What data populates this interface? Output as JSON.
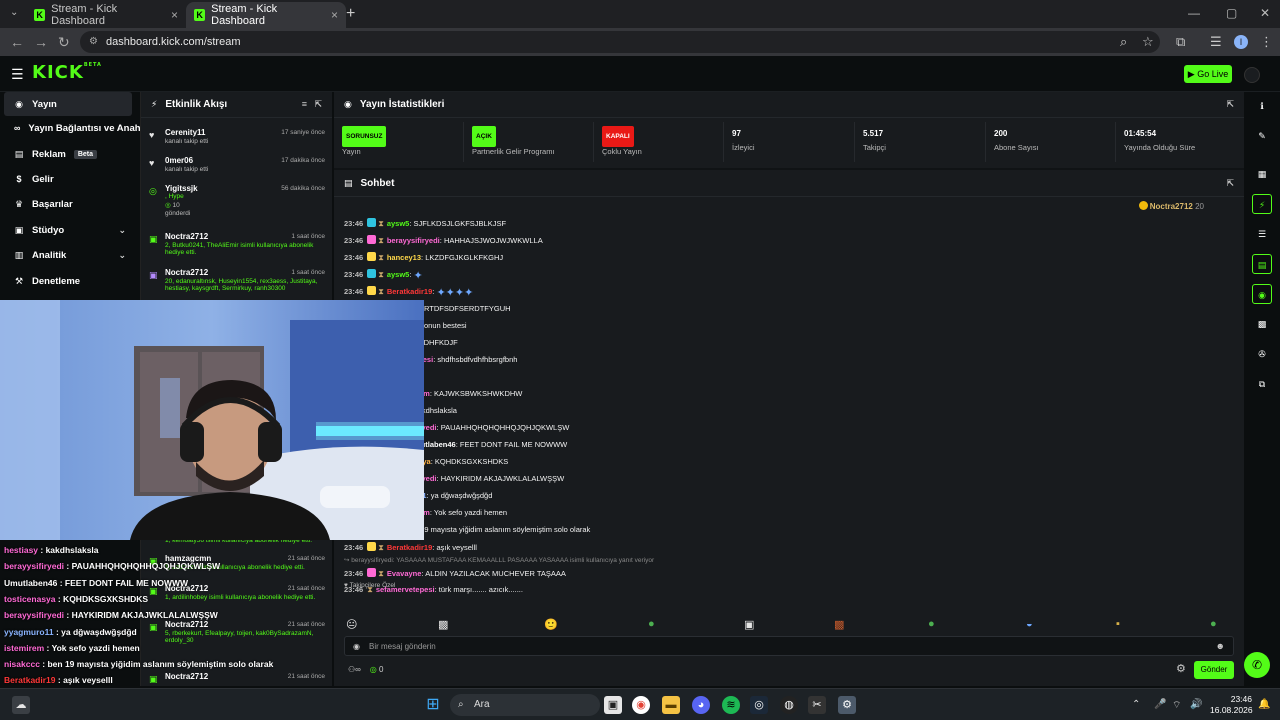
{
  "browser": {
    "tabs": [
      {
        "title": "Stream - Kick Dashboard",
        "favicon": "K"
      },
      {
        "title": "Stream - Kick Dashboard",
        "favicon": "K"
      }
    ],
    "url": "dashboard.kick.com/stream",
    "profile_initial": "I"
  },
  "topbar": {
    "logo": "KICK",
    "logo_beta": "BETA",
    "go_live_label": "Go Live"
  },
  "sidebar": {
    "items": [
      {
        "label": "Yayın",
        "icon": "broadcast-icon"
      },
      {
        "label": "Yayın Bağlantısı ve Anahtarı",
        "icon": "link-icon"
      },
      {
        "label": "Reklam",
        "icon": "ad-icon",
        "badge": "Beta"
      },
      {
        "label": "Gelir",
        "icon": "dollar-icon"
      },
      {
        "label": "Başarılar",
        "icon": "trophy-icon"
      },
      {
        "label": "Stüdyo",
        "icon": "studio-icon"
      },
      {
        "label": "Analitik",
        "icon": "chart-icon"
      },
      {
        "label": "Denetleme",
        "icon": "hammer-icon"
      }
    ]
  },
  "feed": {
    "title": "Etkinlik Akışı",
    "items": [
      {
        "user": "Cerenity11",
        "time": "17 saniye önce",
        "desc": "kanalı takip etti"
      },
      {
        "user": "0mer06",
        "time": "17 dakika önce",
        "desc": "kanalı takip etti"
      },
      {
        "user": "Yigitssjk",
        "time": "56 dakika önce",
        "desc": ", Hype",
        "extra": "10",
        "extra2": "gönderdi"
      },
      {
        "user": "Noctra2712",
        "time": "1 saat önce",
        "desc": "2, Butku0241, TheAliEmir isimli kullanıcıya abonelik hediye etti."
      },
      {
        "user": "Noctra2712",
        "time": "1 saat önce",
        "desc": "20, edanuraltınsk, Huseyin1554, rex3aess, Justitaya, hestiasy, kaysgrdft, Sermirkuy, ranh30300"
      },
      {
        "user": "",
        "time": "",
        "desc": "1, kemoaty56 isimli kullanıcıya abonelik hediye etti."
      },
      {
        "user": "hamzagcmn",
        "time": "21 saat önce",
        "desc": "1, azizzzzs isimli kullanıcıya abonelik hediye etti."
      },
      {
        "user": "Noctra2712",
        "time": "21 saat önce",
        "desc": "1, ardilinhobey isimli kullanıcıya abonelik hediye etti."
      },
      {
        "user": "Noctra2712",
        "time": "21 saat önce",
        "desc": "5, rberkekurt, Efealpayy, toijen, kak0BySadrazamN, erdoly_30"
      },
      {
        "user": "Noctra2712",
        "time": "21 saat önce",
        "desc": ""
      }
    ]
  },
  "stats": {
    "title": "Yayın İstatistikleri",
    "items": [
      {
        "badge": "SORUNSUZ",
        "label": "Yayın",
        "color": "green"
      },
      {
        "badge": "AÇIK",
        "label": "Partnerlik Gelir Programı",
        "color": "green"
      },
      {
        "badge": "KAPALI",
        "label": "Çoklu Yayın",
        "color": "red"
      },
      {
        "value": "97",
        "label": "İzleyici"
      },
      {
        "value": "5.517",
        "label": "Takipçi"
      },
      {
        "value": "200",
        "label": "Abone Sayısı"
      },
      {
        "value": "01:45:54",
        "label": "Yayında Olduğu Süre"
      }
    ]
  },
  "chat": {
    "title": "Sohbet",
    "pinned_user": "Noctra2712",
    "pinned_count": "20",
    "messages": [
      {
        "time": "23:46",
        "user": "aysw5",
        "color": "#53fc18",
        "text": "SJFLKDSJLGKFSJBLKJSF",
        "badge": "#2fc4e0"
      },
      {
        "time": "23:46",
        "user": "berayysifiryedi",
        "color": "#ff6ad5",
        "text": "HAHHAJSJWOJWJWKWLLA",
        "badge": "#ff6ad5"
      },
      {
        "time": "23:46",
        "user": "hancey13",
        "color": "#ffd84a",
        "text": "LKZDFGJKGLKFKGHJ",
        "badge": "#ffd84a"
      },
      {
        "time": "23:46",
        "user": "aysw5",
        "color": "#53fc18",
        "text": "",
        "badge": "#2fc4e0",
        "emotes": 1
      },
      {
        "time": "23:46",
        "user": "Beratkadir19",
        "color": "#ff3838",
        "text": "",
        "badge": "#ffd84a",
        "emotes": 4
      },
      {
        "time": "",
        "user": "",
        "color": "#fff",
        "text": "SERTDFSDFSERDTFYGUH"
      },
      {
        "time": "",
        "user": "",
        "color": "#fff",
        "text": "sefonun bestesi"
      },
      {
        "time": "",
        "user": "",
        "color": "#fff",
        "text": "OJDHFKDJF"
      },
      {
        "time": "",
        "user": "epesi",
        "color": "#ff6ad5",
        "text": "shdfhsbdfvdhfhbsrgfbnh"
      },
      {
        "time": "",
        "user": "",
        "color": "#fff",
        "text": ""
      },
      {
        "time": "",
        "user": "irem",
        "color": "#ff6ad5",
        "text": "KAJWKSBWKSHWKDHW"
      },
      {
        "time": "",
        "user": "",
        "color": "#fff",
        "text": "kakdhslaksla"
      },
      {
        "time": "",
        "user": "firyedi",
        "color": "#ff6ad5",
        "text": "PAUAHHQHQHQHHQJQHJQKWLŞW"
      },
      {
        "time": "",
        "user": "mutlaben46",
        "color": "#fff",
        "text": "FEET DONT FAIL ME NOWWW"
      },
      {
        "time": "",
        "user": "asya",
        "color": "#ffb347",
        "text": "KQHDKSGXKSHDKS"
      },
      {
        "time": "",
        "user": "firyedi",
        "color": "#ff6ad5",
        "text": "HAYKIRIDM AKJAJWKLALALWŞŞW"
      },
      {
        "time": "",
        "user": "o11",
        "color": "#8ab4ff",
        "text": "ya dğwaşdwğşdğd"
      },
      {
        "time": "",
        "user": "irem",
        "color": "#ff6ad5",
        "text": "Yok sefo yazdi hemen"
      },
      {
        "time": "",
        "user": "",
        "color": "#fff",
        "text": "n 19 mayısta yiğidim aslanım söylemiştim solo olarak"
      },
      {
        "time": "23:46",
        "user": "Beratkadir19",
        "color": "#ff3838",
        "text": "aşık veyselll",
        "badge": "#ffd84a"
      },
      {
        "time": "23:46",
        "user": "Evavayne",
        "color": "#ff6ad5",
        "text": "ALDIN YAZILACAK MUCHEVER TAŞAAA",
        "badge": "#ff6ad5",
        "reply": "berayysifiryedi: YASAAAA MUSTAFAAA KEMAAALLL PASAAAA YASAAAA isimli kullanıcıya yanıt veriyor"
      },
      {
        "time": "23:46",
        "user": "sefamervetepesi",
        "color": "#ff6ad5",
        "text": "türk marşı....... azıcık.......",
        "badge": ""
      }
    ],
    "followers_only": "Takipçilere Özel",
    "input_placeholder": "Bir mesaj gönderin",
    "footer_count": "0",
    "send_label": "Gönder"
  },
  "overlay_chat": [
    {
      "user": "hestiasy",
      "color": "#ff6ad5",
      "text": "kakdhslaksla"
    },
    {
      "user": "berayysifiryedi",
      "color": "#ff6ad5",
      "text": "PAUAHHQHQHQHHQJQHJQKWLŞW"
    },
    {
      "user": "Umutlaben46",
      "color": "#ffffff",
      "text": "FEET DONT FAIL ME NOWWW"
    },
    {
      "user": "tosticenasya",
      "color": "#ff6ad5",
      "text": "KQHDKSGXKSHDKS"
    },
    {
      "user": "berayysifiryedi",
      "color": "#ff6ad5",
      "text": "HAYKIRIDM AKJAJWKLALALWŞŞW"
    },
    {
      "user": "yyagmuro11",
      "color": "#8ab4ff",
      "text": "ya dğwaşdwğşdğd"
    },
    {
      "user": "istemirem",
      "color": "#ff6ad5",
      "text": "Yok sefo yazdi hemen"
    },
    {
      "user": "nisakccc",
      "color": "#ff6ad5",
      "text": "ben 19 mayısta yiğidim aslanım söylemiştim solo olarak"
    },
    {
      "user": "Beratkadir19",
      "color": "#ff3838",
      "text": "aşık veyselll"
    },
    {
      "user": "Evavayne",
      "color": "#ff6ad5",
      "text": "ALDIN YAZILACAK MUCHEVER TAŞAAA"
    },
    {
      "user": "sefamervetepesi",
      "color": "#ff6ad5",
      "text": "türk marşı....... azıcık......."
    }
  ],
  "taskbar": {
    "search_label": "Ara",
    "time": "23:46",
    "date": "16.08.2026"
  }
}
